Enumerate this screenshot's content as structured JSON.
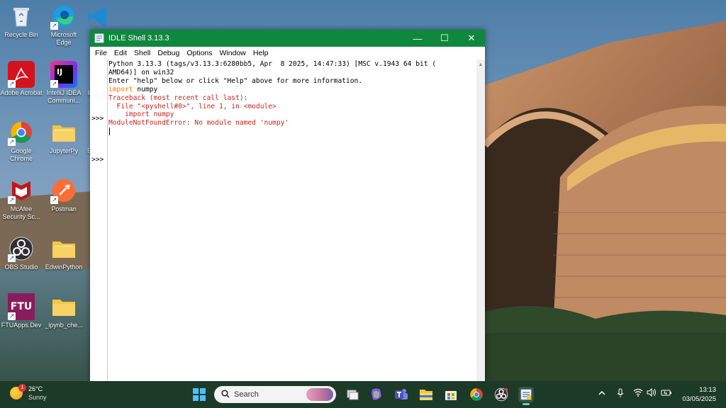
{
  "desktop": {
    "icons": [
      {
        "label": "Recycle Bin"
      },
      {
        "label": "Microsoft Edge"
      },
      {
        "label": "V"
      },
      {
        "label": "Adobe Acrobat"
      },
      {
        "label": "IntelliJ IDEA Communi..."
      },
      {
        "label": "I("
      },
      {
        "label": "Google Chrome"
      },
      {
        "label": "JupyterPy"
      },
      {
        "label": "E"
      },
      {
        "label": "McAfee Security Sc..."
      },
      {
        "label": "Postman"
      },
      {
        "label": "OBS Studio"
      },
      {
        "label": "EdwinPython"
      },
      {
        "label": "FTUApps.Dev"
      },
      {
        "label": "_ipynb_che..."
      }
    ],
    "ij_text": "IJ",
    "ftu_text": "FTU"
  },
  "window": {
    "title": "IDLE Shell 3.13.3",
    "menu": [
      "File",
      "Edit",
      "Shell",
      "Debug",
      "Options",
      "Window",
      "Help"
    ],
    "minimize_glyph": "—",
    "maximize_glyph": "☐",
    "close_glyph": "✕"
  },
  "shell": {
    "prompts": [
      ">>>",
      ">>>"
    ],
    "lines": [
      {
        "text": "Python 3.13.3 (tags/v3.13.3:6280bb5, Apr  8 2025, 14:47:33) [MSC v.1943 64 bit (",
        "style": ""
      },
      {
        "text": "AMD64)] on win32",
        "style": ""
      },
      {
        "text": "Enter \"help\" below or click \"Help\" above for more information.",
        "style": ""
      },
      {
        "text": "import",
        "style": "kw",
        "rest": " numpy"
      },
      {
        "text": "Traceback (most recent call last):",
        "style": "err"
      },
      {
        "text": "  File \"<pyshell#0>\", line 1, in <module>",
        "style": "err"
      },
      {
        "text": "    import numpy",
        "style": "err"
      },
      {
        "text": "ModuleNotFoundError: No module named 'numpy'",
        "style": "err"
      }
    ]
  },
  "taskbar": {
    "weather_temp": "26°C",
    "weather_desc": "Sunny",
    "weather_badge": "1",
    "search_placeholder": "Search",
    "time": "13:13",
    "date": "03/05/2025",
    "icons": [
      "start-icon",
      "search-icon",
      "task-view-icon",
      "copilot-icon",
      "teams-icon",
      "file-explorer-icon",
      "store-icon",
      "chrome-icon",
      "obs-icon",
      "idle-icon"
    ],
    "tray": [
      "chevron-up-icon",
      "microphone-icon",
      "wifi-icon",
      "volume-icon",
      "battery-icon"
    ]
  }
}
